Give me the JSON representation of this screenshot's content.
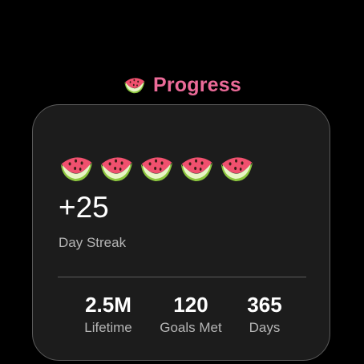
{
  "header": {
    "icon": "watermelon-icon",
    "title": "Progress",
    "title_color": "#ec6b99"
  },
  "streak": {
    "icon": "watermelon-icon",
    "icon_count": 5,
    "value": "+25",
    "label": "Day Streak"
  },
  "stats": [
    {
      "value": "2.5M",
      "label": "Lifetime"
    },
    {
      "value": "120",
      "label": "Goals Met"
    },
    {
      "value": "365",
      "label": "Days"
    }
  ]
}
